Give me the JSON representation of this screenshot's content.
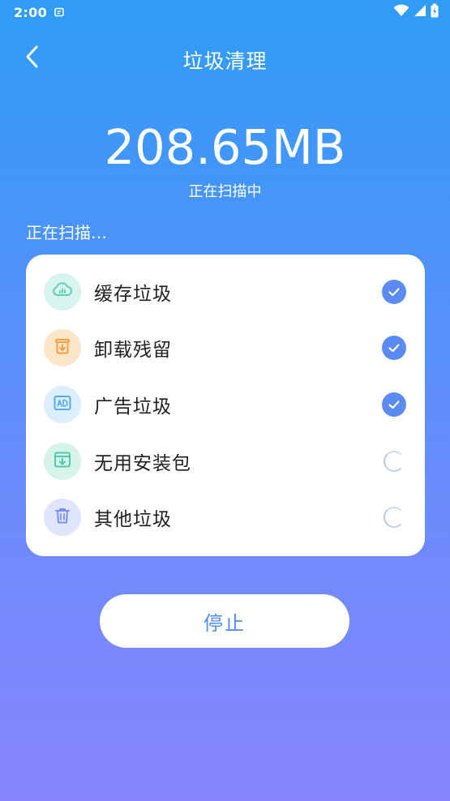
{
  "status_bar": {
    "time": "2:00"
  },
  "header": {
    "title": "垃圾清理"
  },
  "scan": {
    "size": "208.65MB",
    "status": "正在扫描中",
    "progress_label": "正在扫描…"
  },
  "scan_items": [
    {
      "label": "缓存垃圾",
      "icon": "cloud-cache-icon",
      "color": "#62cdb4",
      "bg": "#d8f4ee",
      "state": "done"
    },
    {
      "label": "卸载残留",
      "icon": "uninstall-residue-icon",
      "color": "#f3a046",
      "bg": "#fde6c8",
      "state": "done"
    },
    {
      "label": "广告垃圾",
      "icon": "ad-icon",
      "color": "#57a8ec",
      "bg": "#dbeefc",
      "state": "done"
    },
    {
      "label": "无用安装包",
      "icon": "package-icon",
      "color": "#4ec9a9",
      "bg": "#d6f3ea",
      "state": "scanning"
    },
    {
      "label": "其他垃圾",
      "icon": "trash-icon",
      "color": "#7c8ff3",
      "bg": "#e0e5fc",
      "state": "scanning"
    }
  ],
  "actions": {
    "stop_label": "停止"
  },
  "colors": {
    "accent": "#4f8cf6",
    "check": "#5a8bf3",
    "gradient_top": "#2f9cf8",
    "gradient_bottom": "#8684ff"
  }
}
